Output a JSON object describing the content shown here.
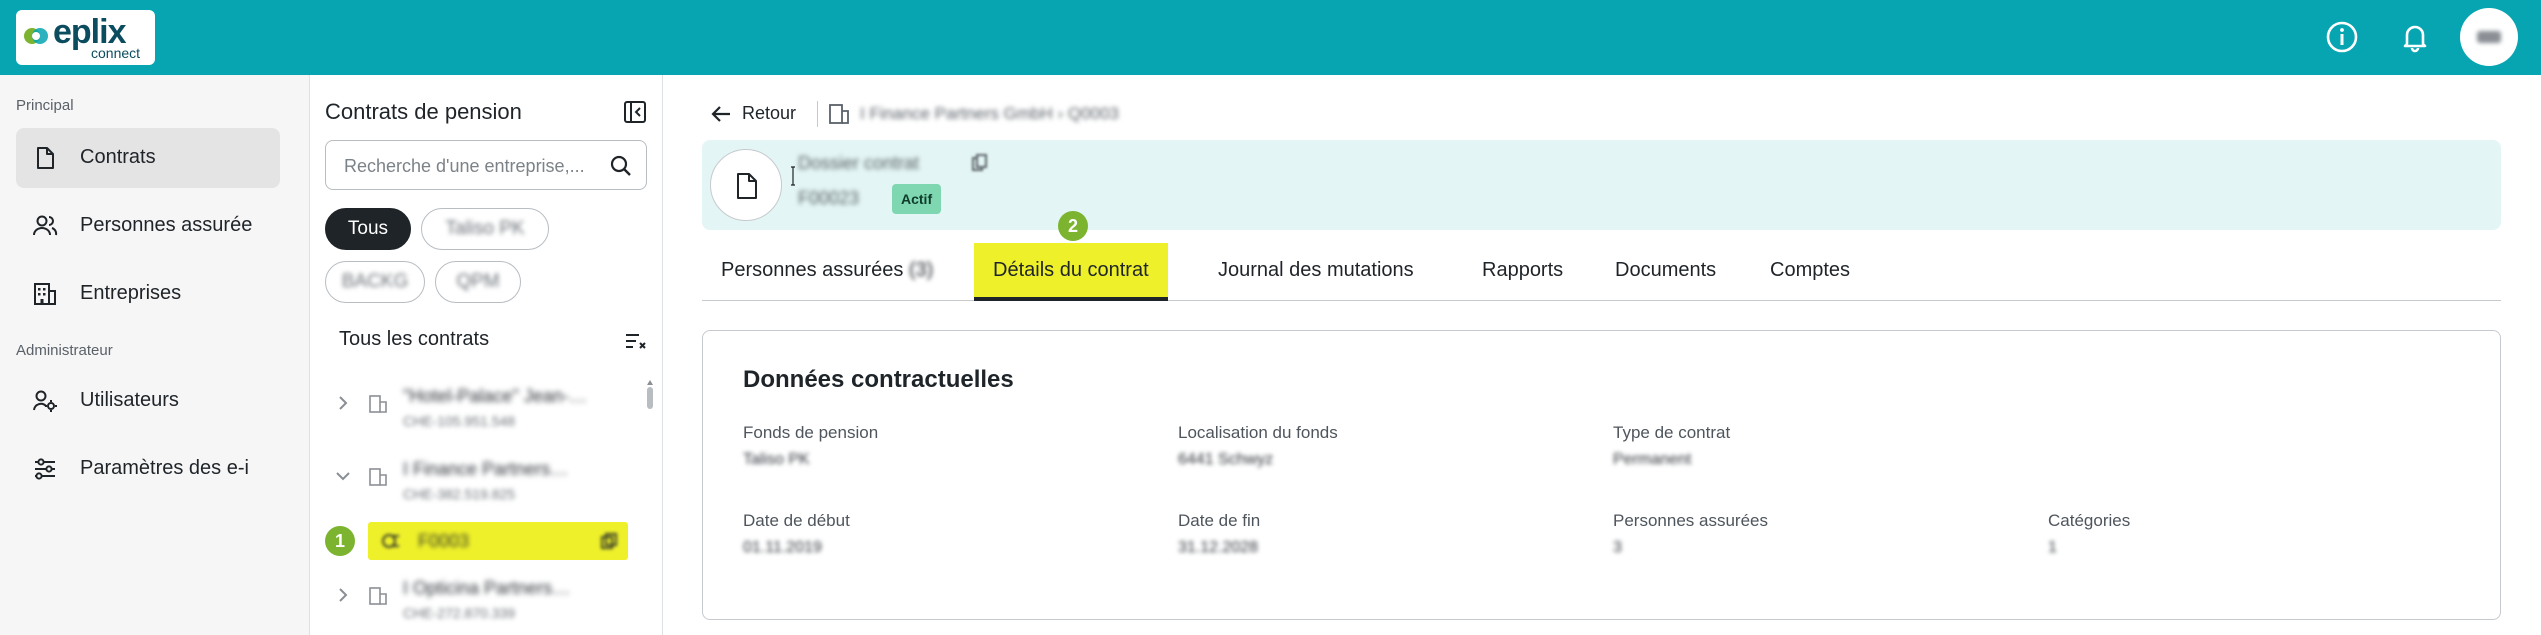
{
  "topbar": {
    "brand": "eplix",
    "brand_sub": "connect",
    "icons": [
      "info-icon",
      "bell-icon",
      "user-avatar"
    ],
    "colors": {
      "bar": "#06a5b1",
      "highlight": "#eef02a",
      "marker": "#7cb430"
    }
  },
  "leftnav": {
    "section_principal": "Principal",
    "section_admin": "Administrateur",
    "items": [
      {
        "label": "Contrats",
        "icon": "document-icon",
        "active": true
      },
      {
        "label": "Personnes assurée",
        "icon": "users-icon",
        "active": false
      },
      {
        "label": "Entreprises",
        "icon": "building-icon",
        "active": false
      },
      {
        "label": "Utilisateurs",
        "icon": "user-gear-icon",
        "active": false
      },
      {
        "label": "Paramètres des e-i",
        "icon": "sliders-icon",
        "active": false
      }
    ]
  },
  "panel": {
    "title": "Contrats de pension",
    "search_placeholder": "Recherche d'une entreprise,...",
    "chips": [
      {
        "label": "Tous",
        "active": true
      },
      {
        "label": "Taliso PK",
        "active": false
      },
      {
        "label": "BACKG",
        "active": false
      },
      {
        "label": "QPM",
        "active": false
      }
    ],
    "list_header": "Tous les contrats",
    "rows": [
      {
        "name": "\"Hotel-Palace\" Jean-…",
        "sub": "CHE-105.951.548",
        "expanded": false
      },
      {
        "name": "I Finance Partners…",
        "sub": "CHE-382.519.825",
        "expanded": true
      },
      {
        "name": "I Opticina Partners…",
        "sub": "CHE-272.870.339",
        "expanded": false
      }
    ],
    "selected_contract": "F0003",
    "marker_1": "1"
  },
  "main": {
    "back_label": "Retour",
    "breadcrumb": "I Finance Partners GmbH  ›  Q0003",
    "header": {
      "title": "Dossier contrat",
      "id": "F00023",
      "status": "Actif"
    },
    "marker_2": "2",
    "tabs": [
      {
        "label": "Personnes assurées",
        "count": "(3)",
        "active": false
      },
      {
        "label": "Détails du contrat",
        "active": true
      },
      {
        "label": "Journal des mutations",
        "active": false
      },
      {
        "label": "Rapports",
        "active": false
      },
      {
        "label": "Documents",
        "active": false
      },
      {
        "label": "Comptes",
        "active": false
      }
    ],
    "section_title": "Données contractuelles",
    "fields": {
      "fonds": {
        "label": "Fonds de pension",
        "value": "Taliso PK"
      },
      "localisation": {
        "label": "Localisation du fonds",
        "value": "6441 Schwyz"
      },
      "type": {
        "label": "Type de contrat",
        "value": "Permanent"
      },
      "debut": {
        "label": "Date de début",
        "value": "01.11.2019"
      },
      "fin": {
        "label": "Date de fin",
        "value": "31.12.2028"
      },
      "personnes": {
        "label": "Personnes assurées",
        "value": "3"
      },
      "categories": {
        "label": "Catégories",
        "value": "1"
      }
    }
  }
}
